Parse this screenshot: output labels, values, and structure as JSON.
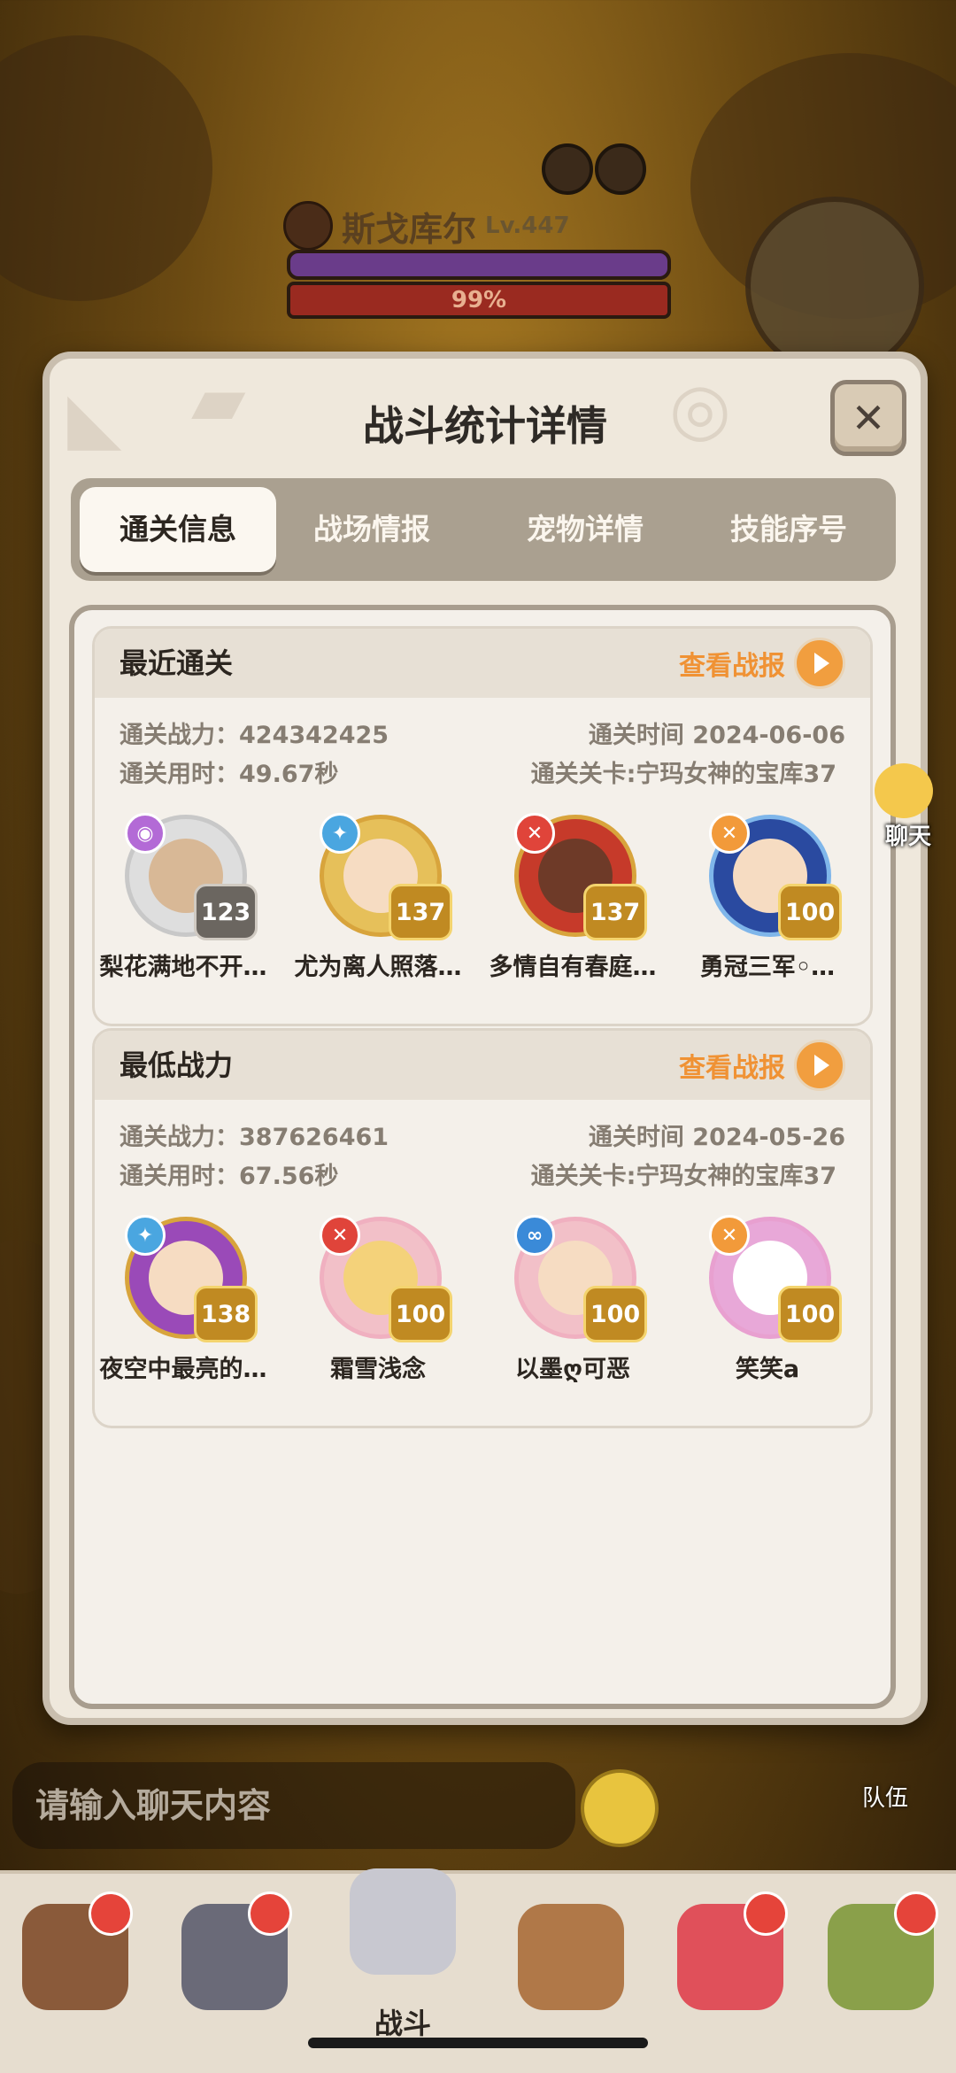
{
  "boss": {
    "name": "斯戈库尔",
    "level": "Lv.447",
    "hp_percent": "99%"
  },
  "modal": {
    "title": "战斗统计详情",
    "tabs": [
      {
        "label": "通关信息",
        "active": true
      },
      {
        "label": "战场情报",
        "active": false
      },
      {
        "label": "宠物详情",
        "active": false
      },
      {
        "label": "技能序号",
        "active": false
      }
    ]
  },
  "cards": [
    {
      "title": "最近通关",
      "view_label": "查看战报",
      "power_label": "通关战力：424342425",
      "time_label": "通关用时：49.67秒",
      "date_label": "通关时间  2024-06-06",
      "stage_label": "通关关卡:宁玛女神的宝库37",
      "pets": [
        {
          "name": "梨花满地不开…",
          "level": "123"
        },
        {
          "name": "尤为离人照落…",
          "level": "137"
        },
        {
          "name": "多情自有春庭…",
          "level": "137"
        },
        {
          "name": "勇冠三军◦…",
          "level": "100"
        }
      ]
    },
    {
      "title": "最低战力",
      "view_label": "查看战报",
      "power_label": "通关战力：387626461",
      "time_label": "通关用时：67.56秒",
      "date_label": "通关时间  2024-05-26",
      "stage_label": "通关关卡:宁玛女神的宝库37",
      "pets": [
        {
          "name": "夜空中最亮的…",
          "level": "138"
        },
        {
          "name": "霜雪浅念",
          "level": "100"
        },
        {
          "name": "以墨ღ可恶",
          "level": "100"
        },
        {
          "name": "笑笑a",
          "level": "100"
        }
      ]
    }
  ],
  "side": {
    "chat_label": "聊天",
    "team_label": "队伍"
  },
  "chat_input": {
    "placeholder": "请输入聊天内容"
  },
  "nav": {
    "battle_label": "战斗"
  },
  "colors": {
    "accent_orange": "#f19e3f",
    "modal_bg": "#efe8dc",
    "tab_bar": "#aaa090"
  }
}
